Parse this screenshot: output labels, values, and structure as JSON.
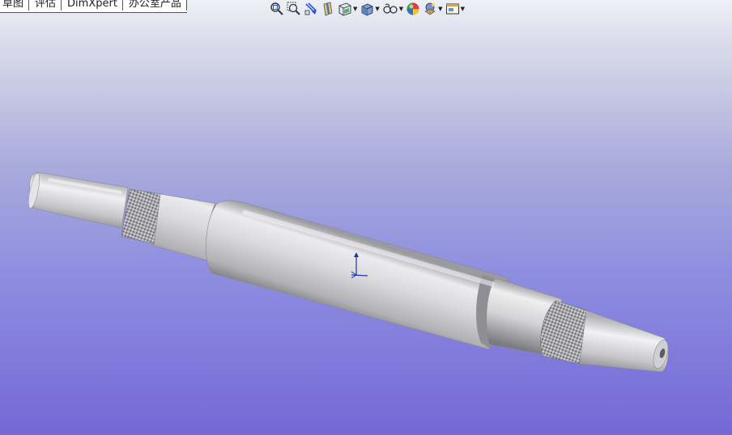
{
  "tabs": [
    {
      "label": "草图"
    },
    {
      "label": "评估"
    },
    {
      "label": "DimXpert"
    },
    {
      "label": "办公室产品"
    }
  ],
  "toolbar": {
    "icons": [
      "zoom-to-fit-icon",
      "zoom-to-area-icon",
      "previous-view-icon",
      "section-view-icon",
      "view-orientation-icon",
      "display-style-icon",
      "hide-show-items-icon",
      "edit-appearance-icon",
      "apply-scene-icon",
      "view-settings-icon"
    ]
  },
  "colors": {
    "background_top": "#eef0f6",
    "background_bottom": "#7468d6",
    "part_metal": "#c8c8cc"
  },
  "viewport": {
    "model": "turned shaft part with knurled sections",
    "triad_axes": [
      "y-axis",
      "z-axis"
    ]
  }
}
